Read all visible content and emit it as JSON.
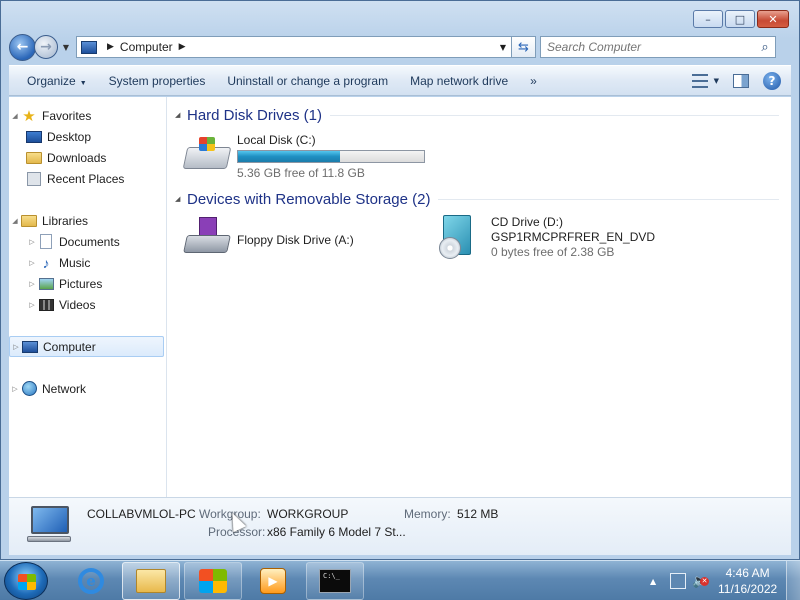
{
  "window": {
    "title_buttons": {
      "minimize": "–",
      "maximize": "□",
      "close": "✕"
    }
  },
  "address_bar": {
    "breadcrumb": "Computer",
    "search_placeholder": "Search Computer"
  },
  "command_bar": {
    "organize": "Organize",
    "system_properties": "System properties",
    "uninstall": "Uninstall or change a program",
    "map_drive": "Map network drive",
    "more": "»"
  },
  "nav_pane": {
    "favorites": "Favorites",
    "desktop": "Desktop",
    "downloads": "Downloads",
    "recent_places": "Recent Places",
    "libraries": "Libraries",
    "documents": "Documents",
    "music": "Music",
    "pictures": "Pictures",
    "videos": "Videos",
    "computer": "Computer",
    "network": "Network"
  },
  "content": {
    "hdd_group": "Hard Disk Drives (1)",
    "removable_group": "Devices with Removable Storage (2)",
    "local_disk": {
      "name": "Local Disk (C:)",
      "free": "5.36 GB free of 11.8 GB",
      "used_fraction": 0.546
    },
    "floppy": {
      "name": "Floppy Disk Drive (A:)"
    },
    "cd": {
      "name": "CD Drive (D:)",
      "label": "GSP1RMCPRFRER_EN_DVD",
      "free": "0 bytes free of 2.38 GB"
    }
  },
  "details": {
    "computer_name": "COLLABVMLOL-PC",
    "workgroup_label": "Workgroup:",
    "workgroup_value": "WORKGROUP",
    "memory_label": "Memory:",
    "memory_value": "512 MB",
    "processor_label": "Processor:",
    "processor_value": "x86 Family 6 Model 7 St..."
  },
  "taskbar": {
    "time": "4:46 AM",
    "date": "11/16/2022",
    "cmd_icon_text": "C:\\_"
  }
}
